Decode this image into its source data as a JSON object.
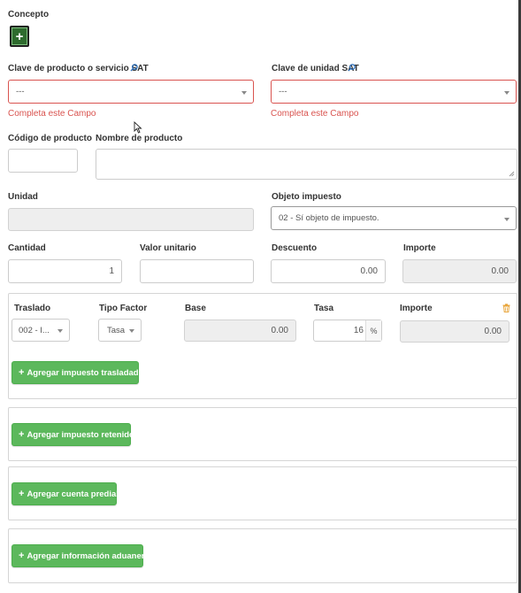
{
  "concepto": {
    "title": "Concepto",
    "add_glyph": "+"
  },
  "clave_producto": {
    "label": "Clave de producto o servicio SAT",
    "value": "---",
    "error": "Completa este Campo"
  },
  "clave_unidad": {
    "label": "Clave de unidad SAT",
    "value": "---",
    "error": "Completa este Campo"
  },
  "codigo_producto": {
    "label": "Código de producto",
    "value": ""
  },
  "nombre_producto": {
    "label": "Nombre de producto",
    "value": ""
  },
  "unidad": {
    "label": "Unidad",
    "value": ""
  },
  "objeto_impuesto": {
    "label": "Objeto impuesto",
    "value": "02 - Sí objeto de impuesto."
  },
  "cantidad": {
    "label": "Cantidad",
    "value": "1"
  },
  "valor_unitario": {
    "label": "Valor unitario",
    "value": ""
  },
  "descuento": {
    "label": "Descuento",
    "value": "0.00"
  },
  "importe": {
    "label": "Importe",
    "value": "0.00"
  },
  "traslado_panel": {
    "headers": {
      "traslado": "Traslado",
      "tipo_factor": "Tipo Factor",
      "base": "Base",
      "tasa": "Tasa",
      "importe": "Importe"
    },
    "row": {
      "traslado": "002 - I...",
      "tipo_factor": "Tasa",
      "base": "0.00",
      "tasa": "16",
      "tasa_unit": "%",
      "importe": "0.00"
    },
    "add_button": "Agregar impuesto trasladado"
  },
  "retenido_panel": {
    "add_button": "Agregar impuesto retenido"
  },
  "predial_panel": {
    "add_button": "Agregar cuenta predial"
  },
  "aduanera_panel": {
    "add_button": "Agregar información aduanera"
  },
  "colors": {
    "green": "#5cb85c",
    "dark_green": "#2e6b2e",
    "error_red": "#d9534f",
    "trash_orange": "#e8a53a"
  }
}
